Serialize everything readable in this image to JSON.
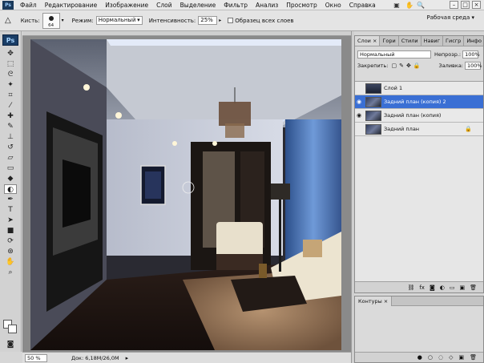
{
  "menu": {
    "logo": "Ps",
    "items": [
      "Файл",
      "Редактирование",
      "Изображение",
      "Слой",
      "Выделение",
      "Фильтр",
      "Анализ",
      "Просмотр",
      "Окно",
      "Справка"
    ]
  },
  "options_bar": {
    "brush_label": "Кисть:",
    "brush_size": "64",
    "mode_label": "Режим:",
    "mode_value": "Нормальный",
    "intensity_label": "Интенсивность:",
    "intensity_value": "25%",
    "sample_all_layers": "Образец всех слоев",
    "workspace": "Рабочая среда"
  },
  "toolbar": {
    "logo": "Ps"
  },
  "status_bar": {
    "zoom": "50 %",
    "doc_info": "Док: 6,18M/26,0M"
  },
  "layers_panel": {
    "tabs": [
      "Слои",
      "Каналы",
      "Стили",
      "Навигатор",
      "Гистограмма",
      "Инфо"
    ],
    "tab_glyphs": [
      "Слои ×",
      "Гори",
      "Стили",
      "Навиг",
      "Гисгр",
      "Инфо"
    ],
    "blend_mode": "Нормальный",
    "opacity_label": "Непрозр.:",
    "opacity_value": "100%",
    "lock_label": "Закрепить:",
    "fill_label": "Заливка:",
    "fill_value": "100%",
    "layers": [
      {
        "name": "Слой 1",
        "visible": false,
        "selected": false,
        "locked": false
      },
      {
        "name": "Задний план (копия) 2",
        "visible": true,
        "selected": true,
        "locked": false
      },
      {
        "name": "Задний план (копия)",
        "visible": true,
        "selected": false,
        "locked": false
      },
      {
        "name": "Задний план",
        "visible": false,
        "selected": false,
        "locked": true
      }
    ]
  },
  "paths_panel": {
    "tab": "Контуры ×"
  },
  "colors": {
    "selection": "#3a6fd4",
    "chrome": "#d6d6d6",
    "canvas_bg": "#8a8a8a"
  }
}
